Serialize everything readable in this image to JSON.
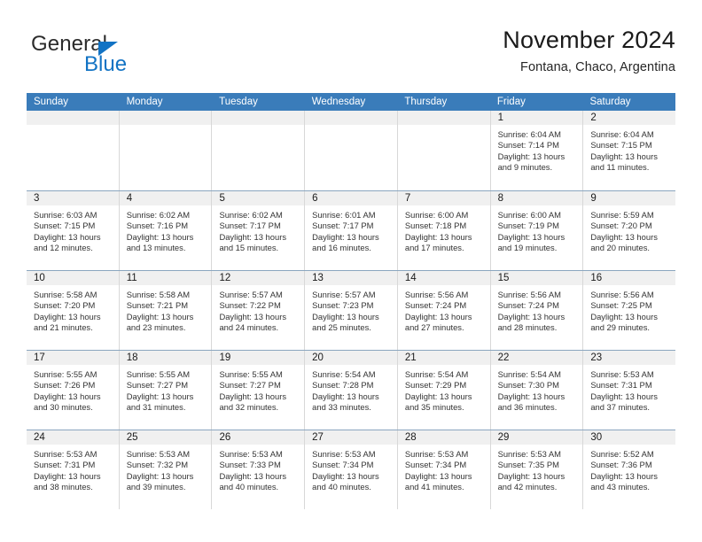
{
  "brand": {
    "name_primary": "General",
    "name_secondary": "Blue"
  },
  "header": {
    "title": "November 2024",
    "subtitle": "Fontana, Chaco, Argentina"
  },
  "colors": {
    "header_band": "#3a7cba",
    "brand_blue": "#1273c4",
    "daynum_band": "#f0f0f0",
    "week_rule": "#8ba6bf",
    "cell_divider": "#d8d8d8"
  },
  "weekday_headers": [
    "Sunday",
    "Monday",
    "Tuesday",
    "Wednesday",
    "Thursday",
    "Friday",
    "Saturday"
  ],
  "weeks": [
    [
      {
        "day": "",
        "detail": ""
      },
      {
        "day": "",
        "detail": ""
      },
      {
        "day": "",
        "detail": ""
      },
      {
        "day": "",
        "detail": ""
      },
      {
        "day": "",
        "detail": ""
      },
      {
        "day": "1",
        "detail": "Sunrise: 6:04 AM\nSunset: 7:14 PM\nDaylight: 13 hours and 9 minutes."
      },
      {
        "day": "2",
        "detail": "Sunrise: 6:04 AM\nSunset: 7:15 PM\nDaylight: 13 hours and 11 minutes."
      }
    ],
    [
      {
        "day": "3",
        "detail": "Sunrise: 6:03 AM\nSunset: 7:15 PM\nDaylight: 13 hours and 12 minutes."
      },
      {
        "day": "4",
        "detail": "Sunrise: 6:02 AM\nSunset: 7:16 PM\nDaylight: 13 hours and 13 minutes."
      },
      {
        "day": "5",
        "detail": "Sunrise: 6:02 AM\nSunset: 7:17 PM\nDaylight: 13 hours and 15 minutes."
      },
      {
        "day": "6",
        "detail": "Sunrise: 6:01 AM\nSunset: 7:17 PM\nDaylight: 13 hours and 16 minutes."
      },
      {
        "day": "7",
        "detail": "Sunrise: 6:00 AM\nSunset: 7:18 PM\nDaylight: 13 hours and 17 minutes."
      },
      {
        "day": "8",
        "detail": "Sunrise: 6:00 AM\nSunset: 7:19 PM\nDaylight: 13 hours and 19 minutes."
      },
      {
        "day": "9",
        "detail": "Sunrise: 5:59 AM\nSunset: 7:20 PM\nDaylight: 13 hours and 20 minutes."
      }
    ],
    [
      {
        "day": "10",
        "detail": "Sunrise: 5:58 AM\nSunset: 7:20 PM\nDaylight: 13 hours and 21 minutes."
      },
      {
        "day": "11",
        "detail": "Sunrise: 5:58 AM\nSunset: 7:21 PM\nDaylight: 13 hours and 23 minutes."
      },
      {
        "day": "12",
        "detail": "Sunrise: 5:57 AM\nSunset: 7:22 PM\nDaylight: 13 hours and 24 minutes."
      },
      {
        "day": "13",
        "detail": "Sunrise: 5:57 AM\nSunset: 7:23 PM\nDaylight: 13 hours and 25 minutes."
      },
      {
        "day": "14",
        "detail": "Sunrise: 5:56 AM\nSunset: 7:24 PM\nDaylight: 13 hours and 27 minutes."
      },
      {
        "day": "15",
        "detail": "Sunrise: 5:56 AM\nSunset: 7:24 PM\nDaylight: 13 hours and 28 minutes."
      },
      {
        "day": "16",
        "detail": "Sunrise: 5:56 AM\nSunset: 7:25 PM\nDaylight: 13 hours and 29 minutes."
      }
    ],
    [
      {
        "day": "17",
        "detail": "Sunrise: 5:55 AM\nSunset: 7:26 PM\nDaylight: 13 hours and 30 minutes."
      },
      {
        "day": "18",
        "detail": "Sunrise: 5:55 AM\nSunset: 7:27 PM\nDaylight: 13 hours and 31 minutes."
      },
      {
        "day": "19",
        "detail": "Sunrise: 5:55 AM\nSunset: 7:27 PM\nDaylight: 13 hours and 32 minutes."
      },
      {
        "day": "20",
        "detail": "Sunrise: 5:54 AM\nSunset: 7:28 PM\nDaylight: 13 hours and 33 minutes."
      },
      {
        "day": "21",
        "detail": "Sunrise: 5:54 AM\nSunset: 7:29 PM\nDaylight: 13 hours and 35 minutes."
      },
      {
        "day": "22",
        "detail": "Sunrise: 5:54 AM\nSunset: 7:30 PM\nDaylight: 13 hours and 36 minutes."
      },
      {
        "day": "23",
        "detail": "Sunrise: 5:53 AM\nSunset: 7:31 PM\nDaylight: 13 hours and 37 minutes."
      }
    ],
    [
      {
        "day": "24",
        "detail": "Sunrise: 5:53 AM\nSunset: 7:31 PM\nDaylight: 13 hours and 38 minutes."
      },
      {
        "day": "25",
        "detail": "Sunrise: 5:53 AM\nSunset: 7:32 PM\nDaylight: 13 hours and 39 minutes."
      },
      {
        "day": "26",
        "detail": "Sunrise: 5:53 AM\nSunset: 7:33 PM\nDaylight: 13 hours and 40 minutes."
      },
      {
        "day": "27",
        "detail": "Sunrise: 5:53 AM\nSunset: 7:34 PM\nDaylight: 13 hours and 40 minutes."
      },
      {
        "day": "28",
        "detail": "Sunrise: 5:53 AM\nSunset: 7:34 PM\nDaylight: 13 hours and 41 minutes."
      },
      {
        "day": "29",
        "detail": "Sunrise: 5:53 AM\nSunset: 7:35 PM\nDaylight: 13 hours and 42 minutes."
      },
      {
        "day": "30",
        "detail": "Sunrise: 5:52 AM\nSunset: 7:36 PM\nDaylight: 13 hours and 43 minutes."
      }
    ]
  ]
}
